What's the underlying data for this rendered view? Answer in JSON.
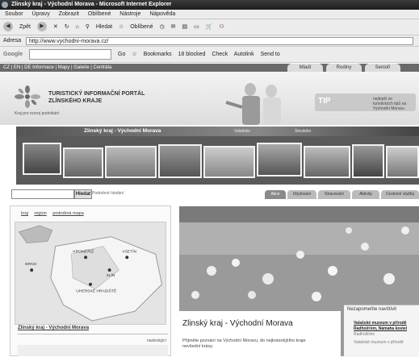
{
  "window": {
    "title": "Zlinský kraj - Východní Morava - Microsoft Internet Explorer"
  },
  "menu": [
    "Soubor",
    "Úpravy",
    "Zobrazit",
    "Oblíbené",
    "Nástroje",
    "Nápověda"
  ],
  "toolbar": {
    "back": "Zpět",
    "search": "Hledat",
    "favorites": "Oblíbené"
  },
  "address": {
    "label": "Adresa",
    "url": "http://www.vychodni-morava.cz/"
  },
  "google": {
    "label": "Google",
    "go": "Go",
    "bookmarks": "Bookmarks",
    "blocked": "18 blocked",
    "check": "Check",
    "autolink": "Autolink",
    "send_to": "Send to"
  },
  "site_nav": {
    "links": "CZ | EN | DE     Informace | Mapy | Galerie | Centrála",
    "tabs": [
      "Mladí",
      "Rodiny",
      "Senioři"
    ]
  },
  "portal": {
    "title_line1": "TURISTICKÝ INFORMAČNÍ PORTÁL",
    "title_line2": "ZLÍNSKÉHO KRAJE",
    "logo_caption": "Kraj pro rozvoj podnikání"
  },
  "tip": {
    "logo": "TIP",
    "text": "nejlepší ze turistických tipů na Východní Moravu"
  },
  "region": {
    "name": "Zlinský kraj - Východní Morava",
    "sub1": "Valašsko",
    "sub2": "Slovácko"
  },
  "search": {
    "button": "Hledat",
    "advanced": "Podrobné hledání"
  },
  "nav_tabs": [
    "Akce",
    "Ubytování",
    "Stravování",
    "Aktivity",
    "Cestovní služby"
  ],
  "map": {
    "links": [
      "kraj",
      "region",
      "podrobná mapa"
    ],
    "cities": [
      "KROMĚŘÍŽ",
      "VSETÍN",
      "ZLÍN",
      "UHERSKÉ HRADIŠTĚ",
      "BRNO"
    ]
  },
  "left": {
    "heading": "Zlinský kraj - Východní Morava",
    "more": "nasledující"
  },
  "main": {
    "title": "Zlinský kraj - Východní Morava",
    "paragraph": "Přijměte pozvání na Východní Moravu, do nejkrásnějšího kraje nevšední krásy."
  },
  "right": {
    "heading": "Nezapomeňte navštívit",
    "link1": "Valašské muzeum v přírodě",
    "link2": "Radhošťém, Námaha kostel",
    "text1": "Radhošťém",
    "text2": "Valašské muzeum v přírodě"
  },
  "colors": {
    "titlebar": "#2a2a2a",
    "header": "#e6e6e6",
    "strip": "#5a5a5a"
  }
}
